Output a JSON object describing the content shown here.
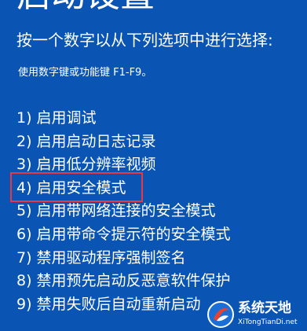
{
  "title": "启动设置",
  "subtitle": "按一个数字以从下列选项中进行选择:",
  "hint": "使用数字键或功能键 F1-F9。",
  "options": [
    {
      "label": "1) 启用调试"
    },
    {
      "label": "2) 启用启动日志记录"
    },
    {
      "label": "3) 启用低分辨率视频"
    },
    {
      "label": "4) 启用安全模式"
    },
    {
      "label": "5) 启用带网络连接的安全模式"
    },
    {
      "label": "6) 启用带命令提示符的安全模式"
    },
    {
      "label": "7) 禁用驱动程序强制签名"
    },
    {
      "label": "8) 禁用预先启动反恶意软件保护"
    },
    {
      "label": "9) 禁用失败后自动重新启动"
    }
  ],
  "highlighted_option": 4,
  "watermark": {
    "name": "系统天地",
    "url": "XiTongTianDi.net"
  },
  "colors": {
    "background": "#0a55b3",
    "text": "#ffffff",
    "highlight": "#e53a45"
  },
  "icons": {
    "watermark_logo": "system-tiandi-logo-icon"
  }
}
